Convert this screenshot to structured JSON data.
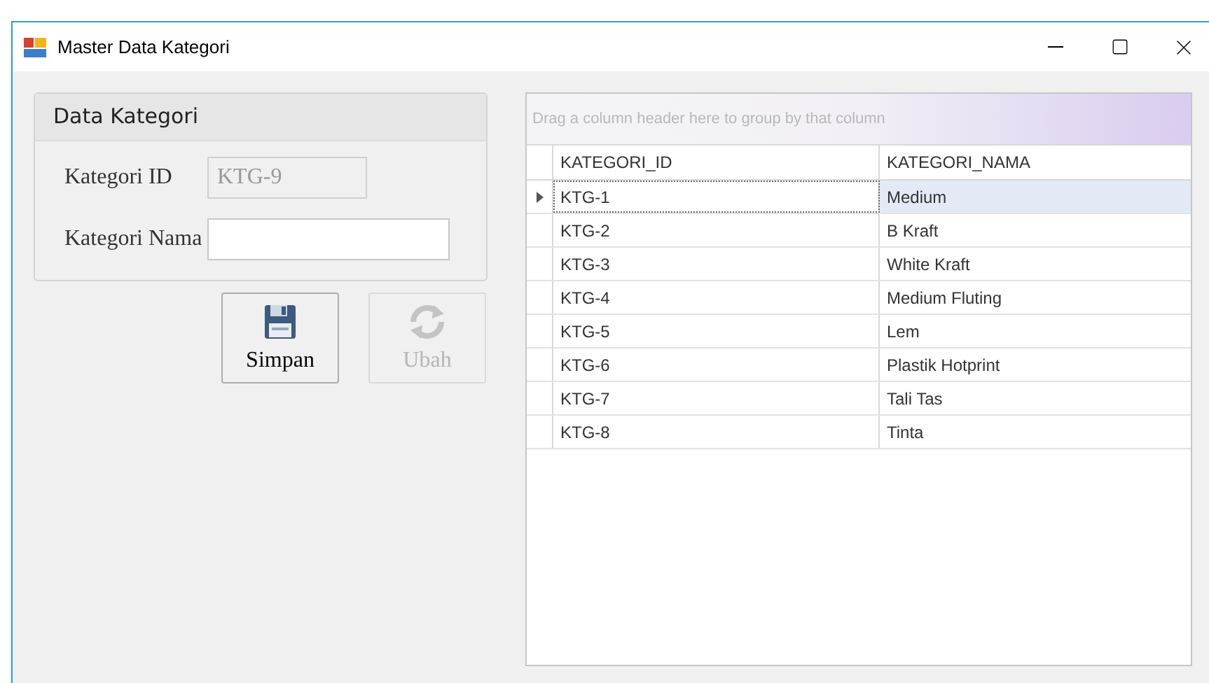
{
  "window": {
    "title": "Master Data Kategori"
  },
  "group": {
    "title": "Data Kategori",
    "fields": [
      {
        "label": "Kategori ID",
        "value": "KTG-9",
        "disabled": true
      },
      {
        "label": "Kategori Nama",
        "disabled": false
      }
    ]
  },
  "buttons": [
    {
      "label": "Simpan",
      "kind": "save",
      "disabled": false
    },
    {
      "label": "Ubah",
      "kind": "refresh",
      "disabled": true
    }
  ],
  "grid": {
    "group_panel": "Drag a column header here to group by that column",
    "columns": [
      "KATEGORI_ID",
      "KATEGORI_NAMA"
    ],
    "rows": [
      {
        "cells": [
          "KTG-1",
          "Medium"
        ],
        "selected": true
      },
      {
        "cells": [
          "KTG-2",
          "B Kraft"
        ],
        "selected": false
      },
      {
        "cells": [
          "KTG-3",
          "White Kraft"
        ],
        "selected": false
      },
      {
        "cells": [
          "KTG-4",
          "Medium Fluting"
        ],
        "selected": false
      },
      {
        "cells": [
          "KTG-5",
          "Lem"
        ],
        "selected": false
      },
      {
        "cells": [
          "KTG-6",
          "Plastik Hotprint"
        ],
        "selected": false
      },
      {
        "cells": [
          "KTG-7",
          "Tali Tas"
        ],
        "selected": false
      },
      {
        "cells": [
          "KTG-8",
          "Tinta"
        ],
        "selected": false
      }
    ]
  }
}
